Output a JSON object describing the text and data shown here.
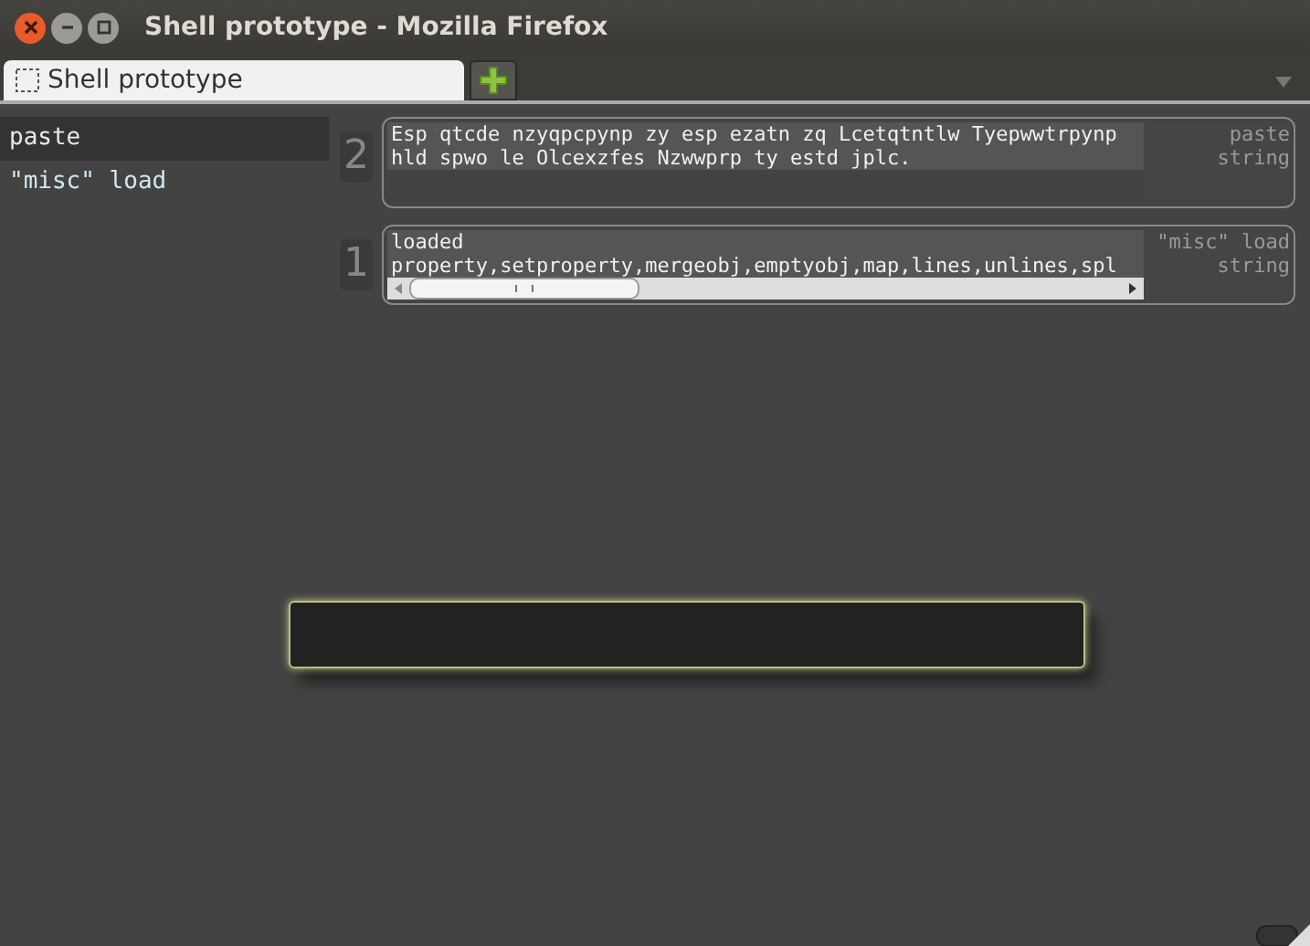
{
  "window": {
    "title": "Shell prototype - Mozilla Firefox"
  },
  "tabs": [
    {
      "label": "Shell prototype",
      "selected": true
    }
  ],
  "sidebar": {
    "items": [
      {
        "label": "paste",
        "selected": true
      },
      {
        "label": "\"misc\" load",
        "selected": false
      }
    ]
  },
  "cells": [
    {
      "kind": "text",
      "number": "2",
      "lines": [
        "Esp qtcde nzyqpcpynp zy esp ezatn zq Lcetqtntlw Tyepwwtrpynp",
        "hld spwo le Olcexzfes Nzwwprp ty estd jplc."
      ],
      "source": "paste",
      "type": "string"
    },
    {
      "kind": "scroll",
      "number": "1",
      "lines": [
        "loaded",
        "property,setproperty,mergeobj,emptyobj,map,lines,unlines,spl"
      ],
      "source": "\"misc\" load",
      "type": "string"
    }
  ]
}
